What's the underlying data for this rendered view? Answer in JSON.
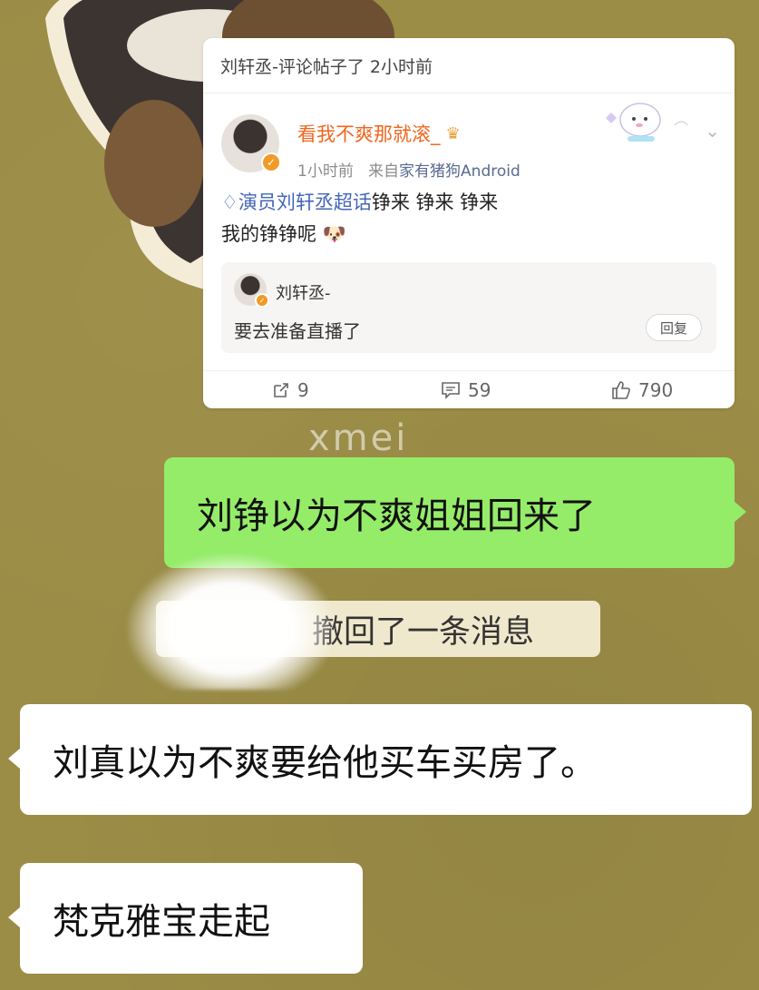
{
  "card": {
    "header": "刘轩丞-评论帖子了 2小时前",
    "username": "看我不爽那就滚_",
    "time": "1小时前",
    "source_prefix": "来自",
    "source_app": "家有猪狗Android",
    "topic": "演员刘轩丞超话",
    "line1_rest": "铮来 铮来 铮来",
    "line2": "我的铮铮呢",
    "reply": {
      "user": "刘轩丞-",
      "text": "要去准备直播了",
      "button": "回复"
    },
    "actions": {
      "repost": "9",
      "comment": "59",
      "like": "790"
    }
  },
  "watermark": "xmei",
  "chat": {
    "msg1": "刘铮以为不爽姐姐回来了",
    "recall": "撤回了一条消息",
    "msg2": "刘真以为不爽要给他买车买房了。",
    "msg3": "梵克雅宝走起"
  },
  "colors": {
    "background": "#9b8c46",
    "green_bubble": "#95ec69",
    "username_orange": "#f0661f",
    "topic_blue": "#4466b8"
  }
}
